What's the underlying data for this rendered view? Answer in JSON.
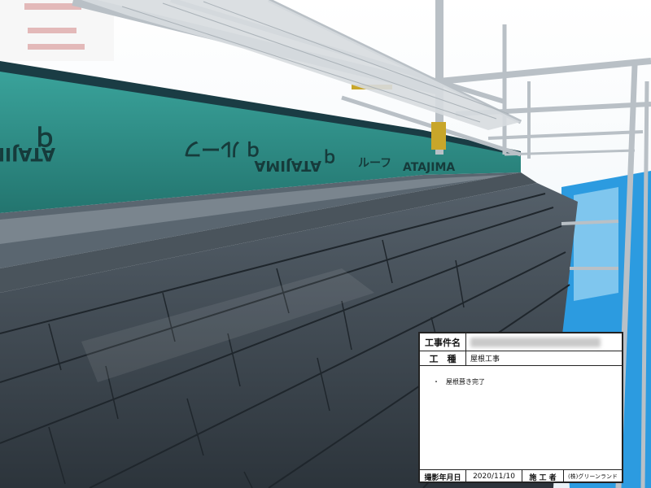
{
  "board": {
    "project_label": "工事件名",
    "work_type_label": "工　種",
    "work_type_value": "屋根工事",
    "remark": "・　屋根葺き完了",
    "date_label": "撮影年月日",
    "date_value": "2020/11/10",
    "contractor_label": "施 工 者",
    "contractor_value": "(株)グリーンランド"
  },
  "membrane": {
    "texts": [
      "ATAJIMA",
      "ルーフ",
      "ATAJIMA",
      "ルーフ",
      "ATAJIMA"
    ]
  },
  "colors": {
    "membrane": "#2f8c86",
    "roof": "#3d4750",
    "sky": "#f4f8fb",
    "tarp": "#1e8fd6"
  }
}
